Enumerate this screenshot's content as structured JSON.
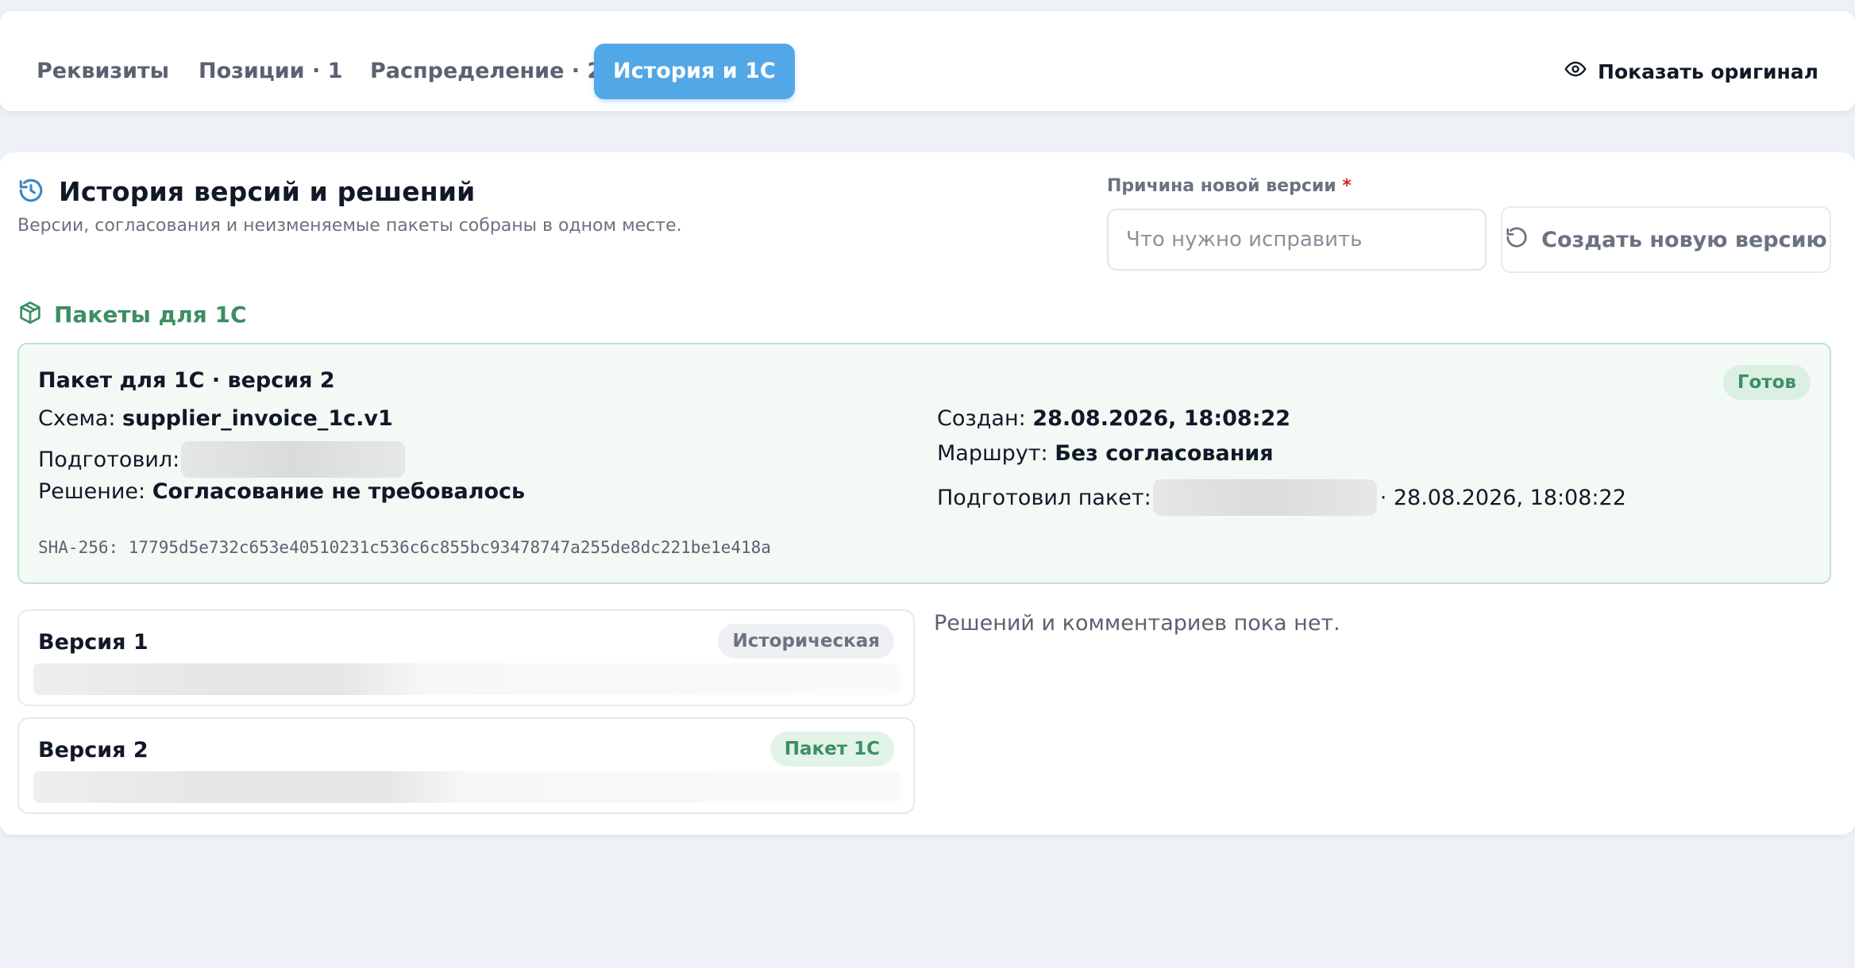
{
  "tabs": [
    {
      "label": "Реквизиты",
      "active": false
    },
    {
      "label": "Позиции · 1",
      "active": false
    },
    {
      "label": "Распределение · 2",
      "active": false
    },
    {
      "label": "История и 1С",
      "active": true
    }
  ],
  "header": {
    "show_original_label": "Показать оригинал",
    "show_original_icon": "eye-icon"
  },
  "history": {
    "title": "История версий и решений",
    "title_icon": "history-icon",
    "subtitle": "Версии, согласования и неизменяемые пакеты собраны в одном месте.",
    "reason_label": "Причина новой версии",
    "reason_required_mark": "*",
    "reason_placeholder": "Что нужно исправить",
    "reason_value": "",
    "create_button_label": "Создать новую версию",
    "create_button_icon": "refresh-icon"
  },
  "packages": {
    "heading": "Пакеты для 1С",
    "heading_icon": "package-icon",
    "items": [
      {
        "title": "Пакет для 1С · версия 2",
        "status": "Готов",
        "schema_label": "Схема:",
        "schema_value": "supplier_invoice_1c.v1",
        "prepared_by_label": "Подготовил:",
        "decision_label": "Решение:",
        "decision_value": "Согласование не требовалось",
        "created_label": "Создан:",
        "created_value": "28.08.2026, 18:08:22",
        "route_label": "Маршрут:",
        "route_value": "Без согласования",
        "package_prepared_by_label": "Подготовил пакет:",
        "package_prepared_at": "· 28.08.2026, 18:08:22",
        "sha": "SHA-256: 17795d5e732c653e40510231c536c6c855bc93478747a255de8dc221be1e418a"
      }
    ]
  },
  "versions": [
    {
      "title": "Версия 1",
      "badge": "Историческая"
    },
    {
      "title": "Версия 2",
      "badge": "Пакет 1С"
    }
  ],
  "decisions": {
    "empty_text": "Решений и комментариев пока нет."
  },
  "colors": {
    "accent": "#52a7e7",
    "success": "#3b8f63",
    "required": "#dc2626",
    "background": "#eef1f5"
  }
}
